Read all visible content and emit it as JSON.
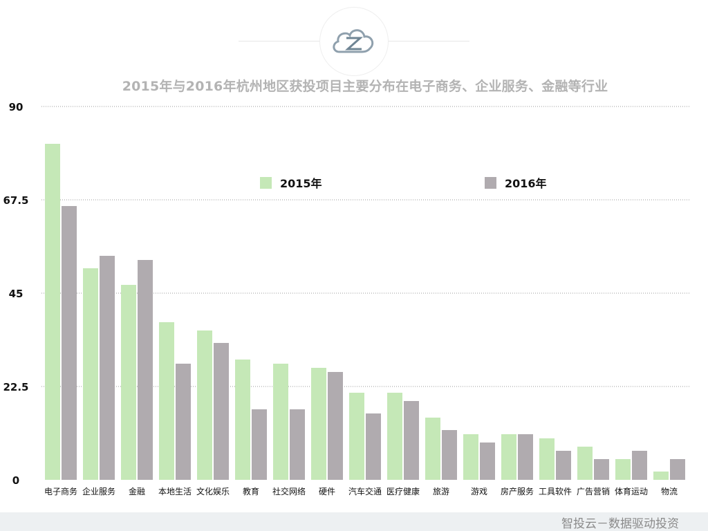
{
  "footer": {
    "text": "智投云－数据驱动投资"
  },
  "logo": {
    "icon": "cloud-letter-z-logo"
  },
  "colors": {
    "series_2015": "#c5e8b7",
    "series_2016": "#b0abaf",
    "grid": "#9a9a9a",
    "title": "#b3b3b3"
  },
  "chart_data": {
    "type": "bar",
    "title": "2015年与2016年杭州地区获投项目主要分布在电子商务、企业服务、金融等行业",
    "xlabel": "",
    "ylabel": "",
    "ylim": [
      0,
      90
    ],
    "yticks": [
      "0",
      "22.5",
      "45",
      "67.5",
      "90"
    ],
    "grid": true,
    "legend_position": "top-center",
    "categories": [
      "电子商务",
      "企业服务",
      "金融",
      "本地生活",
      "文化娱乐",
      "教育",
      "社交网络",
      "硬件",
      "汽车交通",
      "医疗健康",
      "旅游",
      "游戏",
      "房产服务",
      "工具软件",
      "广告营销",
      "体育运动",
      "物流"
    ],
    "series": [
      {
        "name": "2015年",
        "color": "#c5e8b7",
        "values": [
          81,
          51,
          47,
          38,
          36,
          29,
          28,
          27,
          21,
          21,
          15,
          11,
          11,
          10,
          8,
          5,
          2
        ]
      },
      {
        "name": "2016年",
        "color": "#b0abaf",
        "values": [
          66,
          54,
          53,
          28,
          33,
          17,
          17,
          26,
          16,
          19,
          12,
          9,
          11,
          7,
          5,
          7,
          5
        ]
      }
    ]
  }
}
